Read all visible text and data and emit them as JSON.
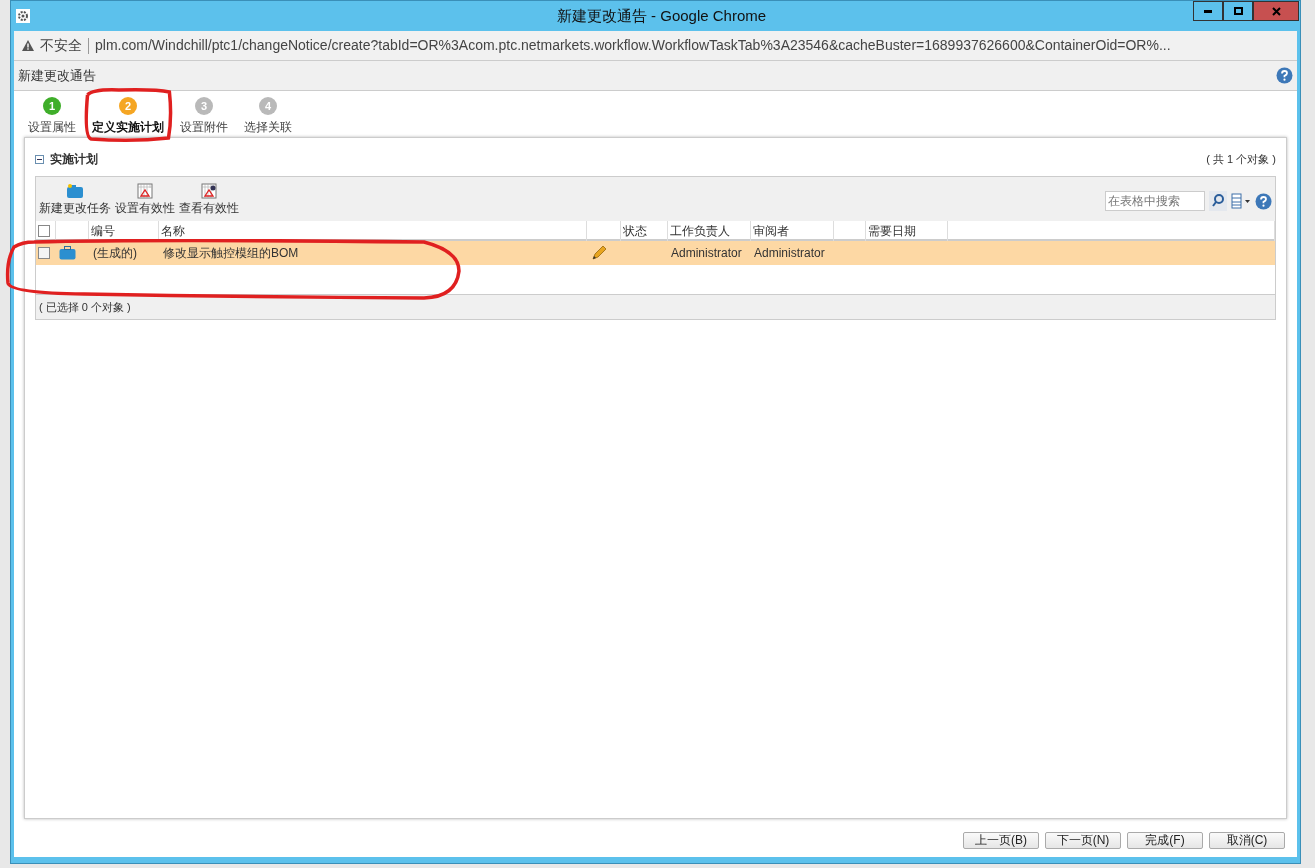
{
  "window": {
    "title": "新建更改通告 - Google Chrome"
  },
  "address_bar": {
    "security": "不安全",
    "url": "plm.com/Windchill/ptc1/changeNotice/create?tabId=OR%3Acom.ptc.netmarkets.workflow.WorkflowTaskTab%3A23546&cacheBuster=1689937626600&ContainerOid=OR%..."
  },
  "page": {
    "title": "新建更改通告"
  },
  "steps": [
    {
      "number": "1",
      "label": "设置属性",
      "completed": true,
      "selected": false
    },
    {
      "number": "2",
      "label": "定义实施计划",
      "completed": false,
      "selected": true
    },
    {
      "number": "3",
      "label": "设置附件",
      "completed": false,
      "selected": false
    },
    {
      "number": "4",
      "label": "选择关联",
      "completed": false,
      "selected": false
    }
  ],
  "panel": {
    "title": "实施计划",
    "expanded": true,
    "count": "( 共 1 个对象 )",
    "all_checked": false,
    "toolbar": [
      {
        "label": "新建更改任务",
        "kind": "folder"
      },
      {
        "label": "设置有效性",
        "kind": "calendar"
      },
      {
        "label": "查看有效性",
        "kind": "calendar-view"
      }
    ],
    "search": {
      "placeholder": "在表格中搜索"
    },
    "columns": [
      "",
      "",
      "编号",
      "名称",
      "",
      "状态",
      "工作负责人",
      "审阅者",
      "",
      "需要日期",
      ""
    ],
    "rows": [
      {
        "checked": false,
        "highlighted": true,
        "number": "(生成的)",
        "name": "修改显示触控模组的BOM",
        "owner": "Administrator",
        "reviewer": "Administrator"
      }
    ],
    "footer": "( 已选择 0 个对象 )"
  },
  "buttons": [
    "上一页(B)",
    "下一页(N)",
    "完成(F)",
    "取消(C)"
  ]
}
